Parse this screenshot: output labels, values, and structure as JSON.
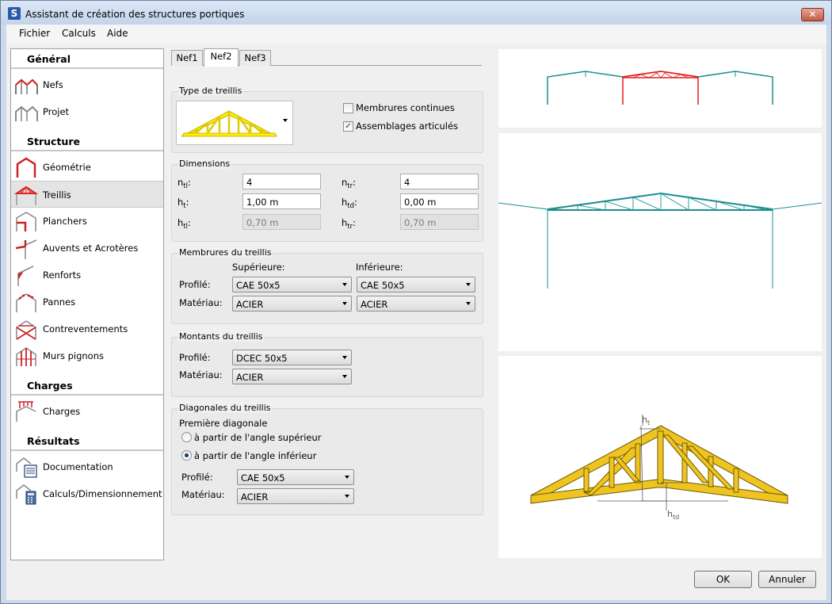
{
  "window": {
    "title": "Assistant de création des structures portiques",
    "app_icon": "S",
    "close_glyph": "✕"
  },
  "menu": [
    "Fichier",
    "Calculs",
    "Aide"
  ],
  "sidebar": {
    "sections": [
      "Général",
      "Structure",
      "Charges",
      "Résultats"
    ],
    "items": [
      {
        "label": "Nefs",
        "icon": "nef-icon"
      },
      {
        "label": "Projet",
        "icon": "projet-icon"
      },
      {
        "label": "Géométrie",
        "icon": "geometrie-icon"
      },
      {
        "label": "Treillis",
        "icon": "treillis-icon"
      },
      {
        "label": "Planchers",
        "icon": "planchers-icon"
      },
      {
        "label": "Auvents et Acrotères",
        "icon": "auvents-icon"
      },
      {
        "label": "Renforts",
        "icon": "renforts-icon"
      },
      {
        "label": "Pannes",
        "icon": "pannes-icon"
      },
      {
        "label": "Contreventements",
        "icon": "contreventements-icon"
      },
      {
        "label": "Murs pignons",
        "icon": "murs-pignons-icon"
      },
      {
        "label": "Charges",
        "icon": "charges-icon"
      },
      {
        "label": "Documentation",
        "icon": "documentation-icon"
      },
      {
        "label": "Calculs/Dimensionnement",
        "icon": "calculs-icon"
      }
    ],
    "selected": "Treillis"
  },
  "tabs": [
    "Nef1",
    "Nef2",
    "Nef3"
  ],
  "active_tab": "Nef2",
  "type_treillis": {
    "title": "Type de treillis",
    "membrures_continues": {
      "label": "Membrures continues",
      "checked": false
    },
    "assemblages_articules": {
      "label": "Assemblages articulés",
      "checked": true
    }
  },
  "dimensions": {
    "title": "Dimensions",
    "n_tl": {
      "symbol": "n",
      "sub": "tl",
      "value": "4"
    },
    "n_tr": {
      "symbol": "n",
      "sub": "tr",
      "value": "4"
    },
    "h_t": {
      "symbol": "h",
      "sub": "t",
      "value": "1,00 m"
    },
    "h_td": {
      "symbol": "h",
      "sub": "td",
      "value": "0,00 m"
    },
    "h_tl": {
      "symbol": "h",
      "sub": "tl",
      "value": "0,70 m"
    },
    "h_tr": {
      "symbol": "h",
      "sub": "tr",
      "value": "0,70 m"
    }
  },
  "membrures": {
    "title": "Membrures du treillis",
    "col_sup": "Supérieure:",
    "col_inf": "Inférieure:",
    "profile_label": "Profilé:",
    "material_label": "Matériau:",
    "sup_profile": "CAE 50x5",
    "inf_profile": "CAE 50x5",
    "sup_material": "ACIER",
    "inf_material": "ACIER"
  },
  "montants": {
    "title": "Montants du treillis",
    "profile_label": "Profilé:",
    "material_label": "Matériau:",
    "profile": "DCEC 50x5",
    "material": "ACIER"
  },
  "diagonales": {
    "title": "Diagonales du treillis",
    "first_label": "Première diagonale",
    "opt_sup": "à partir de l'angle supérieur",
    "opt_inf": "à partir de l'angle inférieur",
    "selected": "inf",
    "profile_label": "Profilé:",
    "material_label": "Matériau:",
    "profile": "CAE 50x5",
    "material": "ACIER"
  },
  "diagram_labels": {
    "ht": "h",
    "ht_sub": "t",
    "htd": "h",
    "htd_sub": "td"
  },
  "buttons": {
    "ok": "OK",
    "cancel": "Annuler"
  },
  "colors": {
    "accent": "#2a5aa8",
    "frame": "#1b8f8f",
    "highlight_frame": "#e02020",
    "truss_fill": "#f0c420",
    "truss_selector": "#ffee00"
  }
}
